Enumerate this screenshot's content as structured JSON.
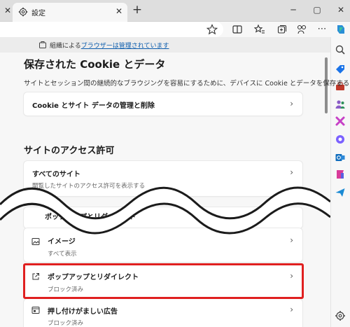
{
  "tab": {
    "title": "設定"
  },
  "managed_notice": {
    "prefix": "組織による",
    "link": "ブラウザーは管理されています"
  },
  "cookie_section": {
    "title": "保存された Cookie とデータ",
    "description": "サイトとセッション間の継続的なブラウジングを容易にするために、デバイスに Cookie とデータを保存する",
    "manage_item": "Cookie とサイト データの管理と削除"
  },
  "permissions_section": {
    "title": "サイトのアクセス許可",
    "all_sites": {
      "label": "すべてのサイト",
      "sub": "閲覧したサイトのアクセス許可を表示する"
    },
    "partial_item": {
      "label": "ポップアップとリダイレクト"
    },
    "images": {
      "label": "イメージ",
      "sub": "すべて表示"
    },
    "popups": {
      "label": "ポップアップとリダイレクト",
      "sub": "ブロック済み"
    },
    "ads": {
      "label": "押し付けがましい広告",
      "sub": "ブロック済み"
    }
  },
  "colors": {
    "highlight": "#e02020",
    "link": "#0b5cad"
  }
}
